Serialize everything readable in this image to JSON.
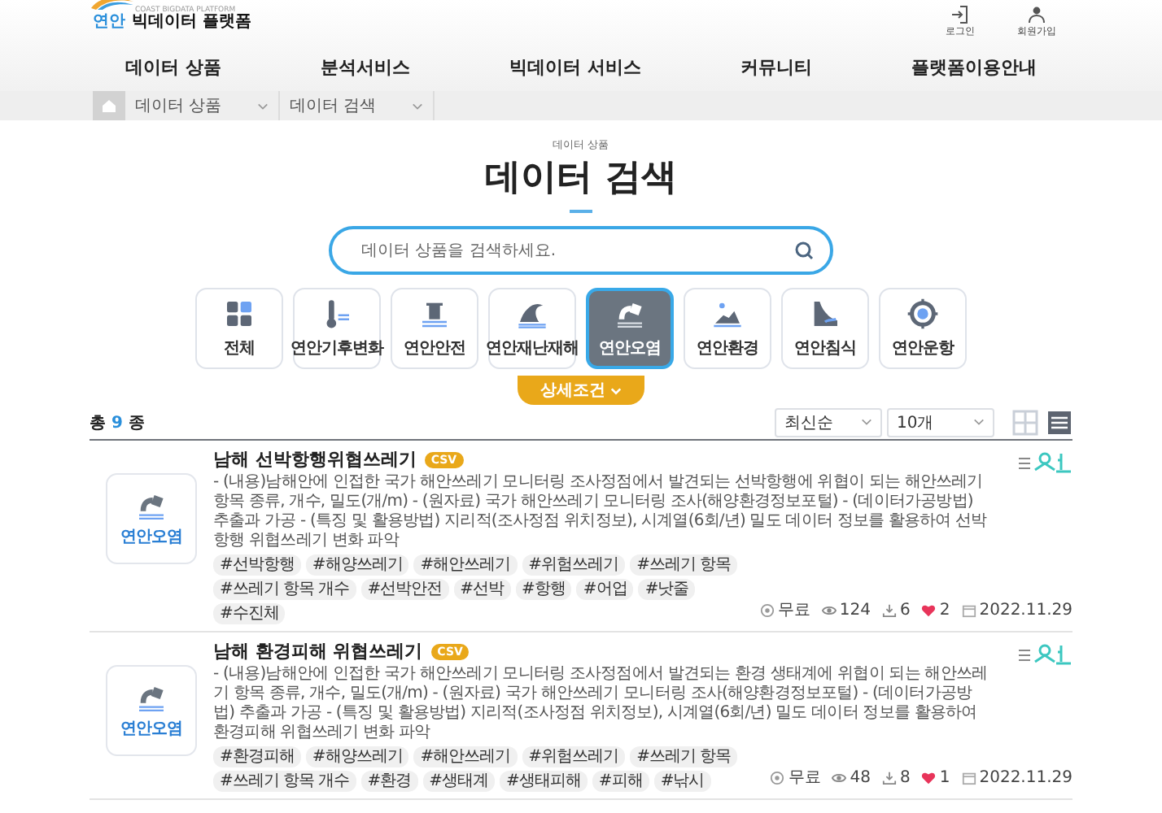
{
  "header": {
    "logo": {
      "mark": "연안",
      "name": "빅데이터 플랫폼",
      "subtitle": "COAST BIGDATA PLATFORM"
    },
    "user_links": [
      {
        "label": "로그인",
        "kind": "login"
      },
      {
        "label": "회원가입",
        "kind": "join"
      }
    ],
    "nav": [
      "데이터 상품",
      "분석서비스",
      "빅데이터 서비스",
      "커뮤니티",
      "플랫폼이용안내"
    ]
  },
  "breadcrumb": [
    "데이터 상품",
    "데이터 검색"
  ],
  "page": {
    "eyebrow": "데이터 상품",
    "title": "데이터 검색"
  },
  "search": {
    "placeholder": "데이터 상품을 검색하세요."
  },
  "categories": [
    {
      "label": "전체",
      "selected": false
    },
    {
      "label": "연안기후변화",
      "selected": false
    },
    {
      "label": "연안안전",
      "selected": false
    },
    {
      "label": "연안재난재해",
      "selected": false
    },
    {
      "label": "연안오염",
      "selected": true
    },
    {
      "label": "연안환경",
      "selected": false
    },
    {
      "label": "연안침식",
      "selected": false
    },
    {
      "label": "연안운항",
      "selected": false
    }
  ],
  "detail_button": "상세조건",
  "results": {
    "count": {
      "prefix": "총",
      "number": "9",
      "suffix": "종"
    },
    "sort": "최신순",
    "page_size": "10개",
    "views": [
      {
        "kind": "grid",
        "selected": false
      },
      {
        "kind": "list",
        "selected": true
      }
    ]
  },
  "products": [
    {
      "category": "연안오염",
      "title": "남해 선박항행위협쓰레기",
      "format": "CSV",
      "description": "- (내용)남해안에 인접한 국가 해안쓰레기 모니터링 조사정점에서 발견되는 선박항행에 위협이 되는 해안쓰레기 항목 종류, 개수, 밀도(개/m) - (원자료) 국가 해안쓰레기 모니터링 조사(해양환경정보포털) - (데이터가공방법) 추출과 가공 - (특징 및 활용방법) 지리적(조사정점 위치정보), 시계열(6회/년) 밀도 데이터 정보를 활용하여 선박항행 위협쓰레기 변화 파악",
      "tags": [
        "#선박항행",
        "#해양쓰레기",
        "#해안쓰레기",
        "#위험쓰레기",
        "#쓰레기 항목",
        "#쓰레기 항목 개수",
        "#선박안전",
        "#선박",
        "#항행",
        "#어업",
        "#낫줄",
        "#수진체"
      ],
      "price": "무료",
      "views": "124",
      "downloads": "6",
      "likes": "2",
      "date": "2022.11.29"
    },
    {
      "category": "연안오염",
      "title": "남해 환경피해 위협쓰레기",
      "format": "CSV",
      "description": "- (내용)남해안에 인접한 국가 해안쓰레기 모니터링 조사정점에서 발견되는 환경 생태계에 위협이 되는 해안쓰레기 항목 종류, 개수, 밀도(개/m) - (원자료) 국가 해안쓰레기 모니터링 조사(해양환경정보포털) - (데이터가공방법) 추출과 가공 - (특징 및 활용방법) 지리적(조사정점 위치정보), 시계열(6회/년) 밀도 데이터 정보를 활용하여 환경피해 위협쓰레기 변화 파악",
      "tags": [
        "#환경피해",
        "#해양쓰레기",
        "#해안쓰레기",
        "#위험쓰레기",
        "#쓰레기 항목",
        "#쓰레기 항목 개수",
        "#환경",
        "#생태계",
        "#생태피해",
        "#피해",
        "#낚시"
      ],
      "price": "무료",
      "views": "48",
      "downloads": "8",
      "likes": "1",
      "date": "2022.11.29"
    }
  ]
}
